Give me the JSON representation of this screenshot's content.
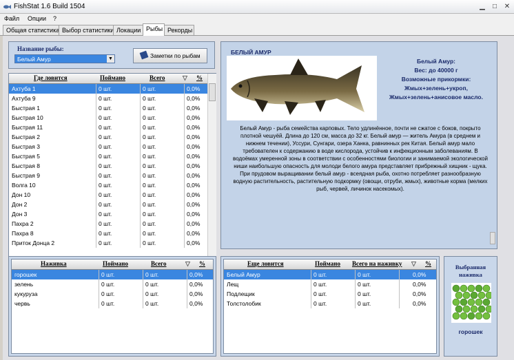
{
  "window": {
    "title": "FishStat 1.6 Build 1504"
  },
  "menu": [
    "Файл",
    "Опции",
    "?"
  ],
  "tabs": [
    "Общая статистика",
    "Выбор статистики",
    "Локации",
    "Рыбы",
    "Рекорды"
  ],
  "fish_select": {
    "label": "Название рыбы:",
    "value": "Белый Амур",
    "notes_button": "Заметки по рыбам"
  },
  "locations_table": {
    "headers": [
      "Где ловится",
      "Поймано",
      "Всего",
      "▽",
      "%"
    ],
    "rows": [
      [
        "Ахтуба 1",
        "0 шт.",
        "0 шт.",
        "0,0%"
      ],
      [
        "Ахтуба 9",
        "0 шт.",
        "0 шт.",
        "0,0%"
      ],
      [
        "Быстрая 1",
        "0 шт.",
        "0 шт.",
        "0,0%"
      ],
      [
        "Быстрая 10",
        "0 шт.",
        "0 шт.",
        "0,0%"
      ],
      [
        "Быстрая 11",
        "0 шт.",
        "0 шт.",
        "0,0%"
      ],
      [
        "Быстрая 2",
        "0 шт.",
        "0 шт.",
        "0,0%"
      ],
      [
        "Быстрая 3",
        "0 шт.",
        "0 шт.",
        "0,0%"
      ],
      [
        "Быстрая 5",
        "0 шт.",
        "0 шт.",
        "0,0%"
      ],
      [
        "Быстрая 8",
        "0 шт.",
        "0 шт.",
        "0,0%"
      ],
      [
        "Быстрая 9",
        "0 шт.",
        "0 шт.",
        "0,0%"
      ],
      [
        "Волга 10",
        "0 шт.",
        "0 шт.",
        "0,0%"
      ],
      [
        "Дон 10",
        "0 шт.",
        "0 шт.",
        "0,0%"
      ],
      [
        "Дон 2",
        "0 шт.",
        "0 шт.",
        "0,0%"
      ],
      [
        "Дон 3",
        "0 шт.",
        "0 шт.",
        "0,0%"
      ],
      [
        "Пахра 2",
        "0 шт.",
        "0 шт.",
        "0,0%"
      ],
      [
        "Пахра 8",
        "0 шт.",
        "0 шт.",
        "0,0%"
      ],
      [
        "Приток Донца 2",
        "0 шт.",
        "0 шт.",
        "0,0%"
      ]
    ]
  },
  "fish_info": {
    "name": "БЕЛЫЙ АМУР",
    "stats": [
      "Белый Амур:",
      "Вес: до 40000 г",
      "Возможные прикормки:",
      "Жмых+зелень+укроп,",
      "Жмых+зелень+анисовое масло."
    ],
    "description": "Белый Амур - рыба семейства карповых. Тело удлинённое, почти не сжатое с боков, покрыто плотной чешуёй. Длина до 120 см, масса до 32 кг. Белый амур — житель Амура (в среднем и нижнем течении), Уссури, Сунгари, озера Ханка, равнинных рек Китая.  Белый амур мало требователен к содержанию в воде кислорода, устойчив к инфекционным заболеваниям. В водоёмах умеренной зоны в соответствии с особенностями биологии и занимаемой экологической ниши наибольшую опасность для молоди белого амура представляет прибрежный хищник - щука. При прудовом выращивании белый амур - всеядная рыба, охотно потребляет разнообразную водную растительность, растительную подкормку (овощи, отруби, жмых), животные корма (мелких рыб, червей, личинок насекомых)."
  },
  "baits_table": {
    "headers": [
      "Наживка",
      "Поймано",
      "Всего",
      "▽",
      "%"
    ],
    "rows": [
      [
        "горошек",
        "0 шт.",
        "0 шт.",
        "0,0%"
      ],
      [
        "зелень",
        "0 шт.",
        "0 шт.",
        "0,0%"
      ],
      [
        "кукуруза",
        "0 шт.",
        "0 шт.",
        "0,0%"
      ],
      [
        "червь",
        "0 шт.",
        "0 шт.",
        "0,0%"
      ]
    ]
  },
  "also_caught_table": {
    "headers": [
      "Еще ловится",
      "Поймано",
      "Всего на наживку",
      "▽",
      "%"
    ],
    "rows": [
      [
        "Белый Амур",
        "0 шт.",
        "0 шт.",
        "0,0%"
      ],
      [
        "Лещ",
        "0 шт.",
        "0 шт.",
        "0,0%"
      ],
      [
        "Подлещик",
        "0 шт.",
        "0 шт.",
        "0,0%"
      ],
      [
        "Толстолобик",
        "0 шт.",
        "0 шт.",
        "0,0%"
      ]
    ]
  },
  "selected_bait": {
    "label": "Выбранная наживка",
    "name": "горошек"
  },
  "colors": {
    "selection": "#3a86e0",
    "panel": "#c9d7ea"
  }
}
